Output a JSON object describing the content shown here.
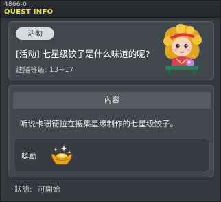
{
  "window": {
    "quest_id": "4866-0",
    "title": "QUEST INFO"
  },
  "quest": {
    "category": "活動",
    "name": "[活动] 七星级饺子是什么味道的呢?",
    "level_label": "建議等级: 13~17"
  },
  "content": {
    "header": "內容",
    "description": "听说卡珊德拉在搜集星缘制作的七星级饺子。"
  },
  "reward": {
    "label": "獎勵",
    "icon": "gold-ingot-icon"
  },
  "status": {
    "label": "狀態:",
    "value": "可開始"
  },
  "colors": {
    "title_yellow": "#f2e24a",
    "background": "#34383e",
    "card": "#42464d"
  }
}
